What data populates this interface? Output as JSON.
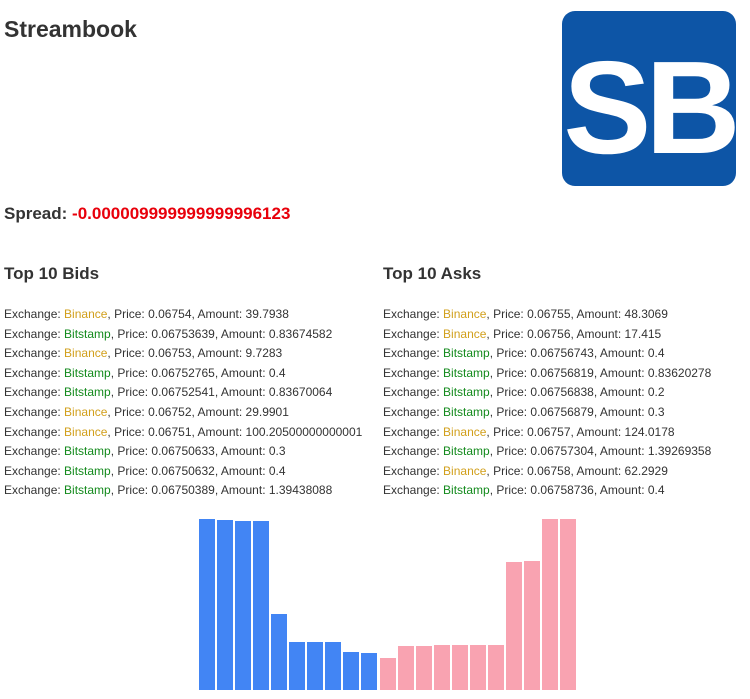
{
  "app": {
    "title": "Streambook",
    "logo_text": "SB",
    "logo_color": "#0d55a6"
  },
  "spread": {
    "label": "Spread:",
    "value": "-0.000009999999999996123"
  },
  "bids": {
    "title": "Top 10 Bids",
    "rows": [
      {
        "exchange": "Binance",
        "price": "0.06754",
        "amount": "39.7938"
      },
      {
        "exchange": "Bitstamp",
        "price": "0.06753639",
        "amount": "0.83674582"
      },
      {
        "exchange": "Binance",
        "price": "0.06753",
        "amount": "9.7283"
      },
      {
        "exchange": "Bitstamp",
        "price": "0.06752765",
        "amount": "0.4"
      },
      {
        "exchange": "Bitstamp",
        "price": "0.06752541",
        "amount": "0.83670064"
      },
      {
        "exchange": "Binance",
        "price": "0.06752",
        "amount": "29.9901"
      },
      {
        "exchange": "Binance",
        "price": "0.06751",
        "amount": "100.20500000000001"
      },
      {
        "exchange": "Bitstamp",
        "price": "0.06750633",
        "amount": "0.3"
      },
      {
        "exchange": "Bitstamp",
        "price": "0.06750632",
        "amount": "0.4"
      },
      {
        "exchange": "Bitstamp",
        "price": "0.06750389",
        "amount": "1.39438088"
      }
    ]
  },
  "asks": {
    "title": "Top 10 Asks",
    "rows": [
      {
        "exchange": "Binance",
        "price": "0.06755",
        "amount": "48.3069"
      },
      {
        "exchange": "Binance",
        "price": "0.06756",
        "amount": "17.415"
      },
      {
        "exchange": "Bitstamp",
        "price": "0.06756743",
        "amount": "0.4"
      },
      {
        "exchange": "Bitstamp",
        "price": "0.06756819",
        "amount": "0.83620278"
      },
      {
        "exchange": "Bitstamp",
        "price": "0.06756838",
        "amount": "0.2"
      },
      {
        "exchange": "Bitstamp",
        "price": "0.06756879",
        "amount": "0.3"
      },
      {
        "exchange": "Binance",
        "price": "0.06757",
        "amount": "124.0178"
      },
      {
        "exchange": "Bitstamp",
        "price": "0.06757304",
        "amount": "1.39269358"
      },
      {
        "exchange": "Binance",
        "price": "0.06758",
        "amount": "62.2929"
      },
      {
        "exchange": "Bitstamp",
        "price": "0.06758736",
        "amount": "0.4"
      }
    ]
  },
  "labels": {
    "exchange": "Exchange: ",
    "price": ", Price: ",
    "amount": ", Amount: "
  },
  "colors": {
    "binance": "#d19f1b",
    "bitstamp": "#138a1c",
    "spread_value": "#e8000b",
    "bid_bar": "#4285f4",
    "ask_bar": "#f9a3b1"
  },
  "chart_data": {
    "type": "bar",
    "series": [
      {
        "side": "bid",
        "color": "#4285f4",
        "values": [
          171,
          170,
          169,
          169,
          76,
          48,
          48,
          48,
          38,
          37
        ]
      },
      {
        "side": "ask",
        "color": "#f9a3b1",
        "values": [
          32,
          44,
          44,
          45,
          45,
          45,
          45,
          128,
          129,
          171,
          171
        ]
      }
    ],
    "ylim": [
      0,
      171
    ],
    "grid": false,
    "legend": "none"
  }
}
